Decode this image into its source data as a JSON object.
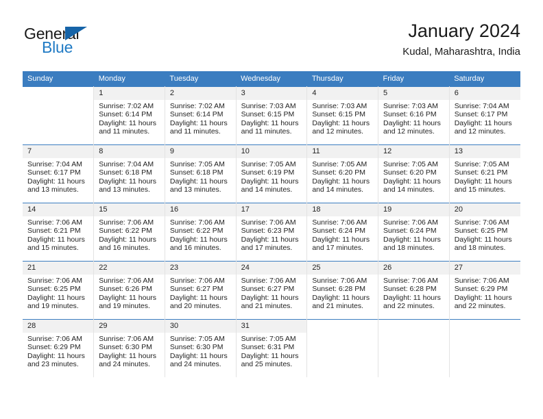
{
  "brand": {
    "name_part1": "General",
    "name_part2": "Blue",
    "triangle_color": "#1664a8",
    "blue_color": "#1f7ac4"
  },
  "header": {
    "title": "January 2024",
    "subtitle": "Kudal, Maharashtra, India"
  },
  "theme": {
    "header_bar_color": "#3b7dc0",
    "daynum_band_color": "#f1f1f1",
    "cell_border_color": "#e3e3e3",
    "text_color": "#222222"
  },
  "weekday_headers": [
    "Sunday",
    "Monday",
    "Tuesday",
    "Wednesday",
    "Thursday",
    "Friday",
    "Saturday"
  ],
  "weeks": [
    [
      {
        "day": "",
        "sunrise": "",
        "sunset": "",
        "daylight": ""
      },
      {
        "day": "1",
        "sunrise": "Sunrise: 7:02 AM",
        "sunset": "Sunset: 6:14 PM",
        "daylight": "Daylight: 11 hours and 11 minutes."
      },
      {
        "day": "2",
        "sunrise": "Sunrise: 7:02 AM",
        "sunset": "Sunset: 6:14 PM",
        "daylight": "Daylight: 11 hours and 11 minutes."
      },
      {
        "day": "3",
        "sunrise": "Sunrise: 7:03 AM",
        "sunset": "Sunset: 6:15 PM",
        "daylight": "Daylight: 11 hours and 11 minutes."
      },
      {
        "day": "4",
        "sunrise": "Sunrise: 7:03 AM",
        "sunset": "Sunset: 6:15 PM",
        "daylight": "Daylight: 11 hours and 12 minutes."
      },
      {
        "day": "5",
        "sunrise": "Sunrise: 7:03 AM",
        "sunset": "Sunset: 6:16 PM",
        "daylight": "Daylight: 11 hours and 12 minutes."
      },
      {
        "day": "6",
        "sunrise": "Sunrise: 7:04 AM",
        "sunset": "Sunset: 6:17 PM",
        "daylight": "Daylight: 11 hours and 12 minutes."
      }
    ],
    [
      {
        "day": "7",
        "sunrise": "Sunrise: 7:04 AM",
        "sunset": "Sunset: 6:17 PM",
        "daylight": "Daylight: 11 hours and 13 minutes."
      },
      {
        "day": "8",
        "sunrise": "Sunrise: 7:04 AM",
        "sunset": "Sunset: 6:18 PM",
        "daylight": "Daylight: 11 hours and 13 minutes."
      },
      {
        "day": "9",
        "sunrise": "Sunrise: 7:05 AM",
        "sunset": "Sunset: 6:18 PM",
        "daylight": "Daylight: 11 hours and 13 minutes."
      },
      {
        "day": "10",
        "sunrise": "Sunrise: 7:05 AM",
        "sunset": "Sunset: 6:19 PM",
        "daylight": "Daylight: 11 hours and 14 minutes."
      },
      {
        "day": "11",
        "sunrise": "Sunrise: 7:05 AM",
        "sunset": "Sunset: 6:20 PM",
        "daylight": "Daylight: 11 hours and 14 minutes."
      },
      {
        "day": "12",
        "sunrise": "Sunrise: 7:05 AM",
        "sunset": "Sunset: 6:20 PM",
        "daylight": "Daylight: 11 hours and 14 minutes."
      },
      {
        "day": "13",
        "sunrise": "Sunrise: 7:05 AM",
        "sunset": "Sunset: 6:21 PM",
        "daylight": "Daylight: 11 hours and 15 minutes."
      }
    ],
    [
      {
        "day": "14",
        "sunrise": "Sunrise: 7:06 AM",
        "sunset": "Sunset: 6:21 PM",
        "daylight": "Daylight: 11 hours and 15 minutes."
      },
      {
        "day": "15",
        "sunrise": "Sunrise: 7:06 AM",
        "sunset": "Sunset: 6:22 PM",
        "daylight": "Daylight: 11 hours and 16 minutes."
      },
      {
        "day": "16",
        "sunrise": "Sunrise: 7:06 AM",
        "sunset": "Sunset: 6:22 PM",
        "daylight": "Daylight: 11 hours and 16 minutes."
      },
      {
        "day": "17",
        "sunrise": "Sunrise: 7:06 AM",
        "sunset": "Sunset: 6:23 PM",
        "daylight": "Daylight: 11 hours and 17 minutes."
      },
      {
        "day": "18",
        "sunrise": "Sunrise: 7:06 AM",
        "sunset": "Sunset: 6:24 PM",
        "daylight": "Daylight: 11 hours and 17 minutes."
      },
      {
        "day": "19",
        "sunrise": "Sunrise: 7:06 AM",
        "sunset": "Sunset: 6:24 PM",
        "daylight": "Daylight: 11 hours and 18 minutes."
      },
      {
        "day": "20",
        "sunrise": "Sunrise: 7:06 AM",
        "sunset": "Sunset: 6:25 PM",
        "daylight": "Daylight: 11 hours and 18 minutes."
      }
    ],
    [
      {
        "day": "21",
        "sunrise": "Sunrise: 7:06 AM",
        "sunset": "Sunset: 6:25 PM",
        "daylight": "Daylight: 11 hours and 19 minutes."
      },
      {
        "day": "22",
        "sunrise": "Sunrise: 7:06 AM",
        "sunset": "Sunset: 6:26 PM",
        "daylight": "Daylight: 11 hours and 19 minutes."
      },
      {
        "day": "23",
        "sunrise": "Sunrise: 7:06 AM",
        "sunset": "Sunset: 6:27 PM",
        "daylight": "Daylight: 11 hours and 20 minutes."
      },
      {
        "day": "24",
        "sunrise": "Sunrise: 7:06 AM",
        "sunset": "Sunset: 6:27 PM",
        "daylight": "Daylight: 11 hours and 21 minutes."
      },
      {
        "day": "25",
        "sunrise": "Sunrise: 7:06 AM",
        "sunset": "Sunset: 6:28 PM",
        "daylight": "Daylight: 11 hours and 21 minutes."
      },
      {
        "day": "26",
        "sunrise": "Sunrise: 7:06 AM",
        "sunset": "Sunset: 6:28 PM",
        "daylight": "Daylight: 11 hours and 22 minutes."
      },
      {
        "day": "27",
        "sunrise": "Sunrise: 7:06 AM",
        "sunset": "Sunset: 6:29 PM",
        "daylight": "Daylight: 11 hours and 22 minutes."
      }
    ],
    [
      {
        "day": "28",
        "sunrise": "Sunrise: 7:06 AM",
        "sunset": "Sunset: 6:29 PM",
        "daylight": "Daylight: 11 hours and 23 minutes."
      },
      {
        "day": "29",
        "sunrise": "Sunrise: 7:06 AM",
        "sunset": "Sunset: 6:30 PM",
        "daylight": "Daylight: 11 hours and 24 minutes."
      },
      {
        "day": "30",
        "sunrise": "Sunrise: 7:05 AM",
        "sunset": "Sunset: 6:30 PM",
        "daylight": "Daylight: 11 hours and 24 minutes."
      },
      {
        "day": "31",
        "sunrise": "Sunrise: 7:05 AM",
        "sunset": "Sunset: 6:31 PM",
        "daylight": "Daylight: 11 hours and 25 minutes."
      },
      {
        "day": "",
        "sunrise": "",
        "sunset": "",
        "daylight": ""
      },
      {
        "day": "",
        "sunrise": "",
        "sunset": "",
        "daylight": ""
      },
      {
        "day": "",
        "sunrise": "",
        "sunset": "",
        "daylight": ""
      }
    ]
  ]
}
